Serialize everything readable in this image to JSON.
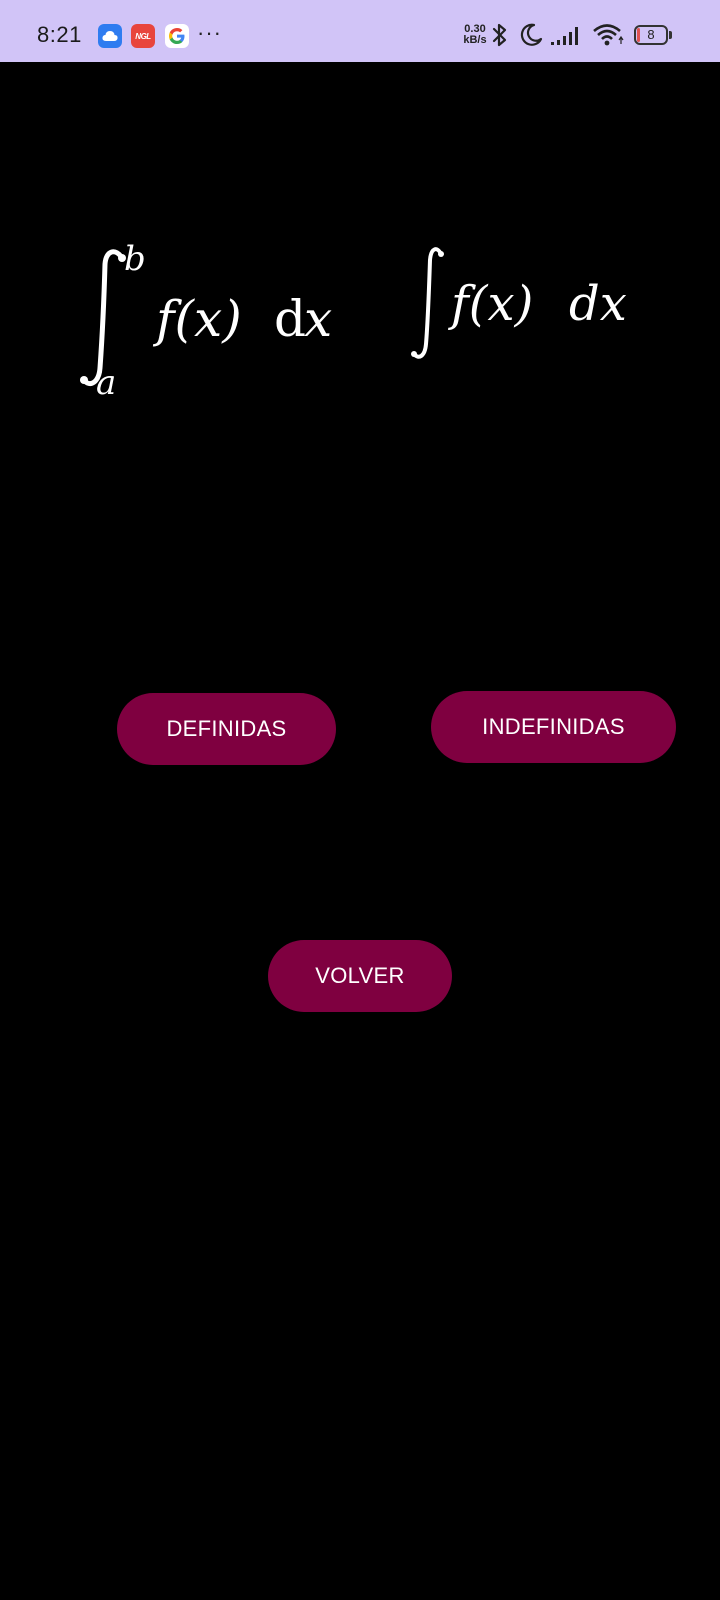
{
  "status_bar": {
    "time": "8:21",
    "notification_icons": [
      "cloud-icon",
      "ngl-icon",
      "google-icon"
    ],
    "ngl_label": "NGL",
    "more_indicator": "···",
    "net_speed_value": "0.30",
    "net_speed_unit": "kB/s",
    "system_icons": [
      "bluetooth-icon",
      "moon-icon",
      "signal-icon",
      "wifi-icon"
    ],
    "battery_level": "8",
    "background_color": "#d1c4f7"
  },
  "formulas": {
    "definite": {
      "lower_limit": "a",
      "upper_limit": "b",
      "integrand": "f(x)",
      "differential_d": "d",
      "differential_var": "x"
    },
    "indefinite": {
      "integrand": "f(x)",
      "differential": "dx"
    }
  },
  "buttons": {
    "definidas": "DEFINIDAS",
    "indefinidas": "INDEFINIDAS",
    "volver": "VOLVER"
  },
  "colors": {
    "background": "#000000",
    "button": "#7f0040",
    "button_text": "#ffffff",
    "formula": "#ffffff"
  }
}
